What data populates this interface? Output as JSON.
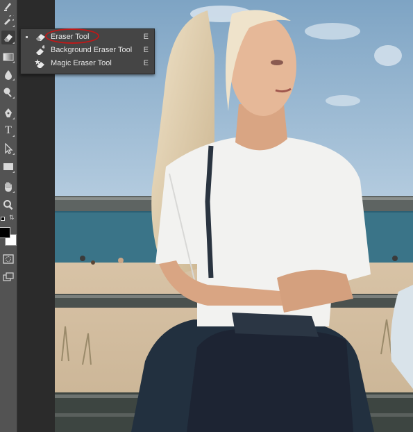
{
  "toolbar": {
    "tools": [
      {
        "name": "brush-icon"
      },
      {
        "name": "history-brush-icon"
      },
      {
        "name": "eraser-icon",
        "active": true
      },
      {
        "name": "gradient-icon"
      },
      {
        "name": "blur-icon"
      },
      {
        "name": "dodge-icon"
      },
      {
        "name": "pen-icon"
      },
      {
        "name": "type-icon",
        "glyph": "T"
      },
      {
        "name": "path-selection-icon"
      },
      {
        "name": "rectangle-icon"
      },
      {
        "name": "hand-icon"
      },
      {
        "name": "zoom-icon"
      }
    ],
    "foreground_color": "#000000",
    "background_color": "#ffffff"
  },
  "flyout": {
    "items": [
      {
        "label": "Eraser Tool",
        "shortcut": "E",
        "selected": true,
        "icon": "eraser-icon"
      },
      {
        "label": "Background Eraser Tool",
        "shortcut": "E",
        "selected": false,
        "icon": "background-eraser-icon"
      },
      {
        "label": "Magic Eraser Tool",
        "shortcut": "E",
        "selected": false,
        "icon": "magic-eraser-icon"
      }
    ],
    "highlight_color": "#c01818"
  },
  "canvas": {
    "description_colors": {
      "sky": "#8fb2cc",
      "sea": "#2f6a80",
      "sand": "#d9c6aa"
    }
  }
}
